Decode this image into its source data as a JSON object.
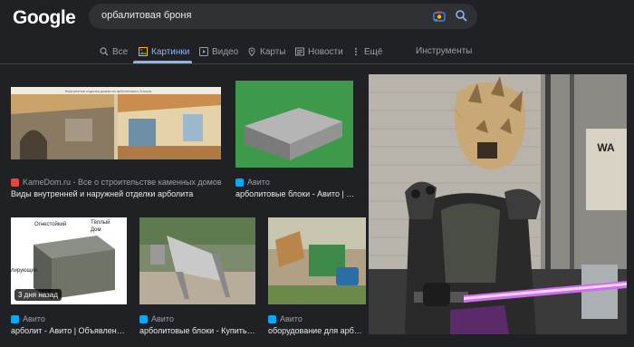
{
  "logo": "Google",
  "search": {
    "query": "орбалитовая броня"
  },
  "tabs": [
    {
      "label": "Все",
      "icon": "search-icon"
    },
    {
      "label": "Картинки",
      "icon": "image-icon",
      "active": true
    },
    {
      "label": "Видео",
      "icon": "play-icon"
    },
    {
      "label": "Карты",
      "icon": "map-pin-icon"
    },
    {
      "label": "Новости",
      "icon": "news-icon"
    },
    {
      "label": "Ещё",
      "icon": "more-icon"
    }
  ],
  "tools_label": "Инструменты",
  "results": [
    {
      "source": "KameDom.ru - Все о строительстве каменных домов из бл...",
      "title": "Виды внутренней и наружней отделки арболита",
      "favicon_color": "#e8453c",
      "header_text": "Внутренняя отделка домов из арболитовых блоков"
    },
    {
      "source": "Авито",
      "title": "арболитовые блоки - Авито | Объя...",
      "favicon_color": "#00aaff"
    },
    {
      "source": "Авито",
      "title": "арболит - Авито | Объявления в ...",
      "favicon_color": "#00aaff",
      "badge": "3 дня назад",
      "labels": [
        "Огнестойкий",
        "Тёплый",
        "Дом",
        "лирующий"
      ]
    },
    {
      "source": "Авито",
      "title": "арболитовые блоки - Купить обо...",
      "favicon_color": "#00aaff"
    },
    {
      "source": "Авито",
      "title": "оборудование для арболитовых...",
      "favicon_color": "#00aaff"
    }
  ],
  "preview": {
    "sign_text": "WA"
  },
  "colors": {
    "accent": "#8ab4f8",
    "background": "#202124"
  }
}
